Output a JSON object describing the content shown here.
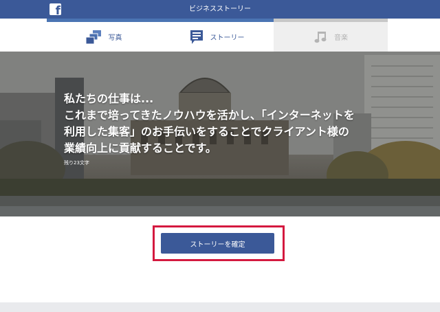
{
  "header": {
    "logo_letter": "f",
    "title": "ビジネスストーリー"
  },
  "tabs": [
    {
      "label": "写真",
      "icon": "photo-stack-icon",
      "state": "active"
    },
    {
      "label": "ストーリー",
      "icon": "story-speech-icon",
      "state": "active"
    },
    {
      "label": "音楽",
      "icon": "music-note-icon",
      "state": "disabled"
    }
  ],
  "hero": {
    "caption_lines": [
      "私たちの仕事は...",
      "これまで培ってきたノウハウを活かし、「インターネットを",
      "利用した集客」のお手伝いをすることでクライアント様の",
      "業績向上に貢献することです。"
    ],
    "remaining_chars": "残り23文字"
  },
  "actions": {
    "confirm_label": "ストーリーを確定"
  },
  "colors": {
    "brand": "#3b5998",
    "tab_accent": "#4a74b3",
    "highlight": "#d4193f"
  }
}
